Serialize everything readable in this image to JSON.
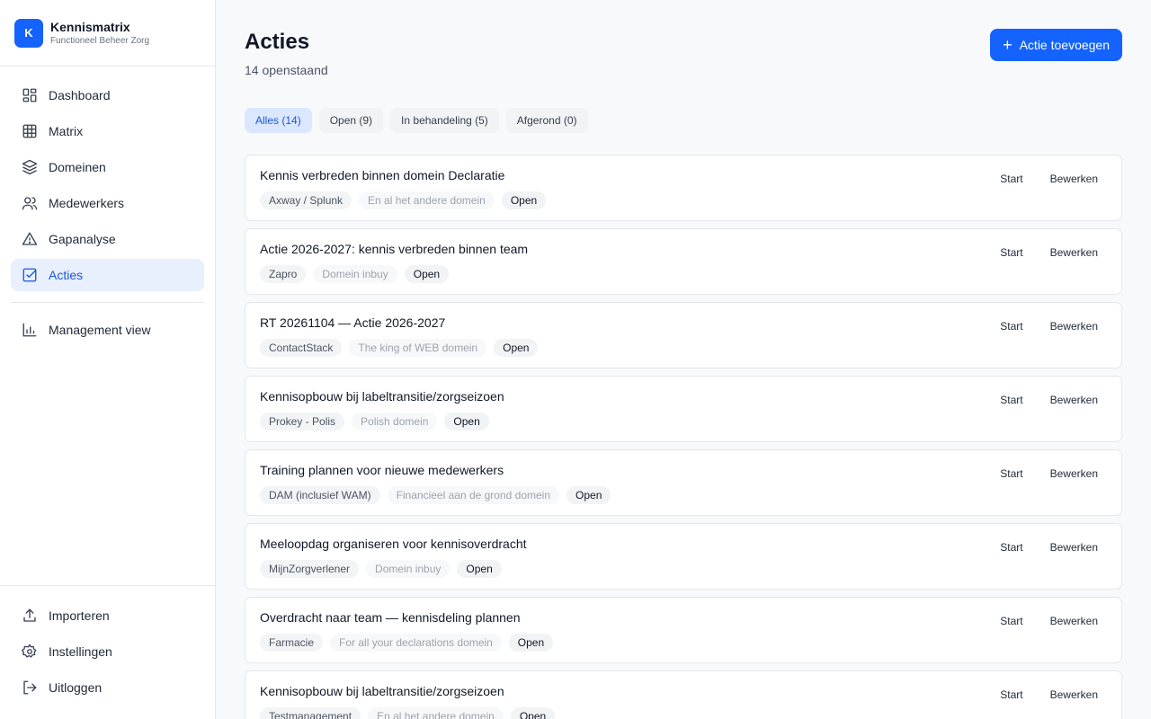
{
  "brand": {
    "logo": "K",
    "title": "Kennismatrix",
    "subtitle": "Functioneel Beheer Zorg"
  },
  "nav": {
    "items": [
      {
        "label": "Dashboard",
        "icon": "dashboard-icon"
      },
      {
        "label": "Matrix",
        "icon": "grid-icon"
      },
      {
        "label": "Domeinen",
        "icon": "layers-icon"
      },
      {
        "label": "Medewerkers",
        "icon": "users-icon"
      },
      {
        "label": "Gapanalyse",
        "icon": "alert-triangle-icon"
      },
      {
        "label": "Acties",
        "icon": "checkbox-icon",
        "active": true
      }
    ],
    "management": {
      "label": "Management view",
      "icon": "bar-chart-icon"
    },
    "bottom": [
      {
        "label": "Importeren",
        "icon": "upload-icon"
      },
      {
        "label": "Instellingen",
        "icon": "gear-icon"
      },
      {
        "label": "Uitloggen",
        "icon": "logout-icon"
      }
    ]
  },
  "header": {
    "title": "Acties",
    "subtitle": "14 openstaand",
    "add_button": "Actie toevoegen"
  },
  "filters": [
    {
      "label": "Alles (14)",
      "active": true
    },
    {
      "label": "Open (9)"
    },
    {
      "label": "In behandeling (5)"
    },
    {
      "label": "Afgerond (0)"
    }
  ],
  "card_actions": {
    "start": "Start",
    "edit": "Bewerken"
  },
  "actions": [
    {
      "title": "Kennis verbreden binnen domein Declaratie",
      "app": "Axway / Splunk",
      "domain": "En al het andere domein",
      "status": "Open"
    },
    {
      "title": "Actie 2026-2027: kennis verbreden binnen team",
      "app": "Zapro",
      "domain": "Domein inbuy",
      "status": "Open"
    },
    {
      "title": "RT 20261104 — Actie 2026-2027",
      "app": "ContactStack",
      "domain": "The king of WEB domein",
      "status": "Open"
    },
    {
      "title": "Kennisopbouw bij labeltransitie/zorgseizoen",
      "app": "Prokey - Polis",
      "domain": "Polish domein",
      "status": "Open"
    },
    {
      "title": "Training plannen voor nieuwe medewerkers",
      "app": "DAM (inclusief WAM)",
      "domain": "Financieel aan de grond domein",
      "status": "Open"
    },
    {
      "title": "Meeloopdag organiseren voor kennisoverdracht",
      "app": "MijnZorgverlener",
      "domain": "Domein inbuy",
      "status": "Open"
    },
    {
      "title": "Overdracht naar team — kennisdeling plannen",
      "app": "Farmacie",
      "domain": "For all your declarations domein",
      "status": "Open"
    },
    {
      "title": "Kennisopbouw bij labeltransitie/zorgseizoen",
      "app": "Testmanagement",
      "domain": "En al het andere domein",
      "status": "Open"
    }
  ],
  "colors": {
    "accent": "#1463ff",
    "active_bg": "#e8f0fe",
    "active_text": "#1a56db"
  }
}
